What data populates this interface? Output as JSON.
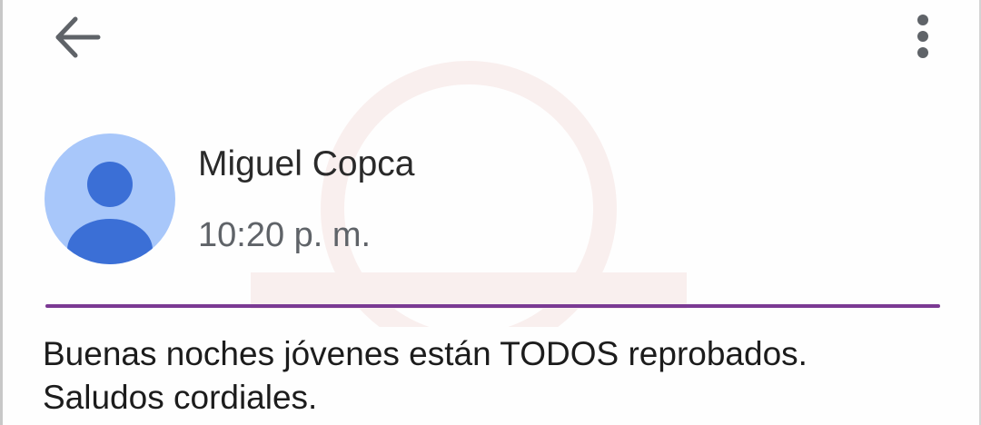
{
  "toolbar": {
    "back_icon": "arrow-left-icon",
    "more_icon": "more-vertical-icon"
  },
  "message": {
    "avatar_icon": "person-icon",
    "sender": "Miguel Copca",
    "time": "10:20 p. m.",
    "body_lines": [
      "Buenas noches jóvenes están TODOS reprobados.",
      "Saludos cordiales."
    ]
  },
  "colors": {
    "avatar_bg": "#a8c7fa",
    "avatar_fg": "#3b6fd6",
    "divider": "#7b3a93"
  }
}
